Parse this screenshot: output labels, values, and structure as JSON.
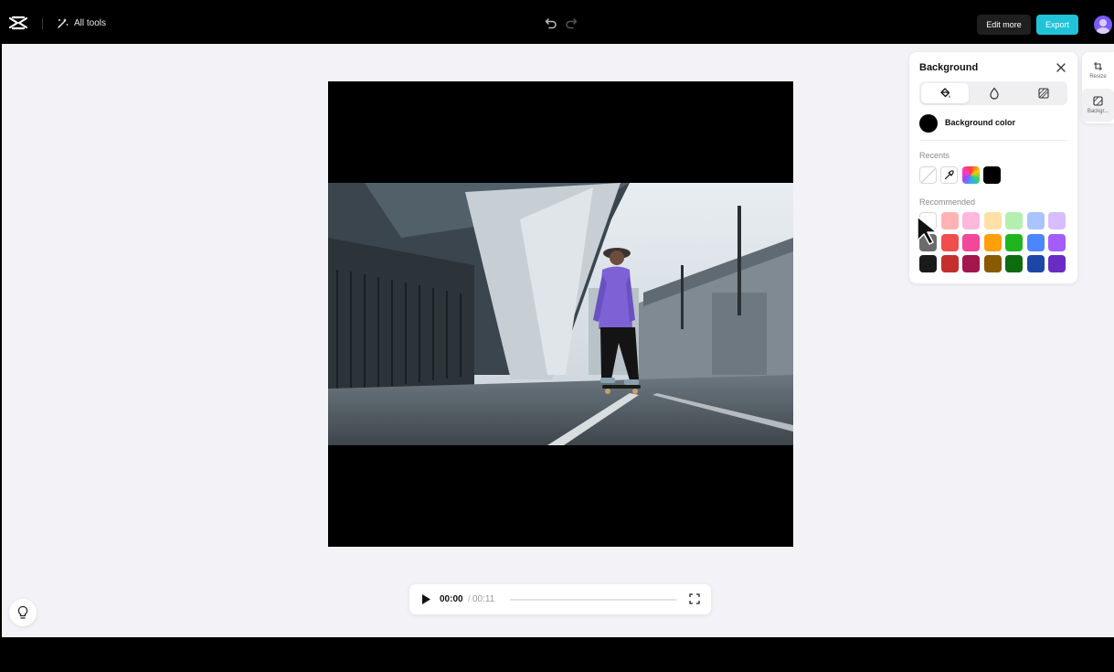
{
  "header": {
    "logo_icon": "capcut-logo-icon",
    "all_tools_label": "All tools",
    "all_tools_icon": "magic-wand-icon",
    "undo_icon": "undo-icon",
    "redo_icon": "redo-icon",
    "edit_more_label": "Edit more",
    "export_label": "Export",
    "export_color": "#21c3d8",
    "avatar_icon": "user-avatar-icon"
  },
  "canvas": {
    "background_color": "#000000",
    "image": "skateboarder-photo"
  },
  "background_panel": {
    "title": "Background",
    "close_icon": "close-icon",
    "tabs": [
      {
        "icon": "paint-bucket-icon",
        "active": true
      },
      {
        "icon": "blur-drop-icon",
        "active": false
      },
      {
        "icon": "image-pattern-icon",
        "active": false
      }
    ],
    "background_color_label": "Background color",
    "current_color": "#000000",
    "recents_label": "Recents",
    "recents": [
      {
        "type": "none"
      },
      {
        "type": "eyedropper",
        "icon": "eyedropper-icon"
      },
      {
        "type": "color-picker",
        "icon": "rainbow-picker-icon"
      },
      {
        "type": "color",
        "color": "#000000"
      }
    ],
    "recommended_label": "Recommended",
    "recommended": [
      [
        "#ffffff",
        "#ffb3b3",
        "#ffb8dc",
        "#ffe0a6",
        "#b3f0b0",
        "#a9c4ff",
        "#d9bcff"
      ],
      [
        "#6b6b6b",
        "#f04e4e",
        "#f2479a",
        "#ff9f0a",
        "#1fb51f",
        "#4c86ff",
        "#a45cff"
      ],
      [
        "#1a1a1a",
        "#c42e2e",
        "#a3164f",
        "#8a5a00",
        "#0d6b10",
        "#1e46a8",
        "#6a2bc4"
      ]
    ]
  },
  "side_rail": {
    "items": [
      {
        "label": "Resize",
        "icon": "resize-icon"
      },
      {
        "label": "Backgr...",
        "icon": "background-icon"
      }
    ]
  },
  "player": {
    "play_icon": "play-icon",
    "current_time": "00:00",
    "separator": "/",
    "total_time": "00:11",
    "progress": 0,
    "fullscreen_icon": "fullscreen-icon"
  },
  "tips_icon": "lightbulb-icon"
}
